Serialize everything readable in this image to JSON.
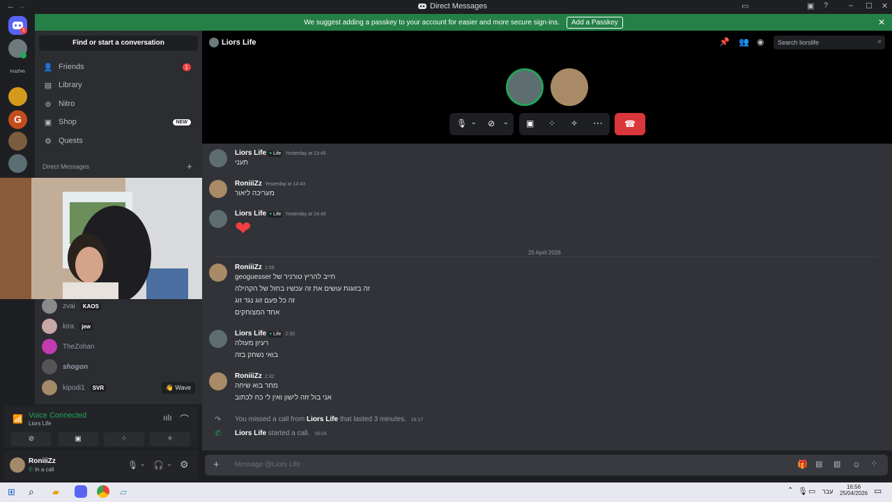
{
  "window": {
    "title": "Direct Messages"
  },
  "banner": {
    "text": "We suggest adding a passkey to your account for easier and more secure sign-ins.",
    "button": "Add a Passkey"
  },
  "sidebar": {
    "find": "Find or start a conversation",
    "nav": [
      {
        "label": "Friends",
        "badge": "1"
      },
      {
        "label": "Library"
      },
      {
        "label": "Nitro"
      },
      {
        "label": "Shop",
        "badge": "NEW"
      },
      {
        "label": "Quests"
      }
    ],
    "dm_header": "Direct Messages",
    "friends": [
      {
        "name": "zvai",
        "tag": "KAOS"
      },
      {
        "name": "kira",
        "tag": "jew"
      },
      {
        "name": "TheZohan",
        "tag": ""
      },
      {
        "name": "shogon",
        "tag": ""
      },
      {
        "name": "kipodi1",
        "tag": "SVR",
        "wave": "Wave"
      }
    ],
    "server_label": "מולקבות"
  },
  "voice": {
    "title": "Voice Connected",
    "sub": "Liors Life"
  },
  "user": {
    "name": "RoniiiZz",
    "status": "In a call"
  },
  "header": {
    "name": "Liors Life",
    "search": "Search liorslife"
  },
  "messages": [
    {
      "user": "Liors Life",
      "tag": "Life",
      "time": "Yesterday at 13:45",
      "lines": [
        "תעני"
      ]
    },
    {
      "user": "RoniiiZz",
      "time": "Yesterday at 14:43",
      "lines": [
        "מעריכה ליאור"
      ]
    },
    {
      "user": "Liors Life",
      "tag": "Life",
      "time": "Yesterday at 14:43",
      "lines": [
        "❤"
      ]
    },
    {
      "user": "RoniiiZz",
      "time": "1:59",
      "lines": [
        "חייב להריץ טורניר של geoguesser",
        "זה בזוגות עושים את זה עכשיו בחול של הקהילה",
        "זה כל פעם זוג נגד זוג",
        "אחד המצוחקים"
      ]
    },
    {
      "user": "Liors Life",
      "tag": "Life",
      "time": "2:30",
      "lines": [
        "רעיון מעולה",
        "בואי נשחק בזה"
      ]
    },
    {
      "user": "RoniiiZz",
      "time": "2:32",
      "lines": [
        "מחר בוא שיחה",
        "אני בול זזה לישון ואין לי כח לכתוב"
      ]
    }
  ],
  "divider": "25 April 2026",
  "missed": {
    "pre": "You missed a call from",
    "user": "Liors Life",
    "post": "that lasted 3 minutes.",
    "time": "16:17"
  },
  "started": {
    "user": "Liors Life",
    "text": "started a call.",
    "time": "16:24"
  },
  "composer": {
    "placeholder": "Message @Liors Life"
  },
  "taskbar": {
    "lang": "עבר",
    "time": "16:56",
    "date": "25/04/2026"
  }
}
